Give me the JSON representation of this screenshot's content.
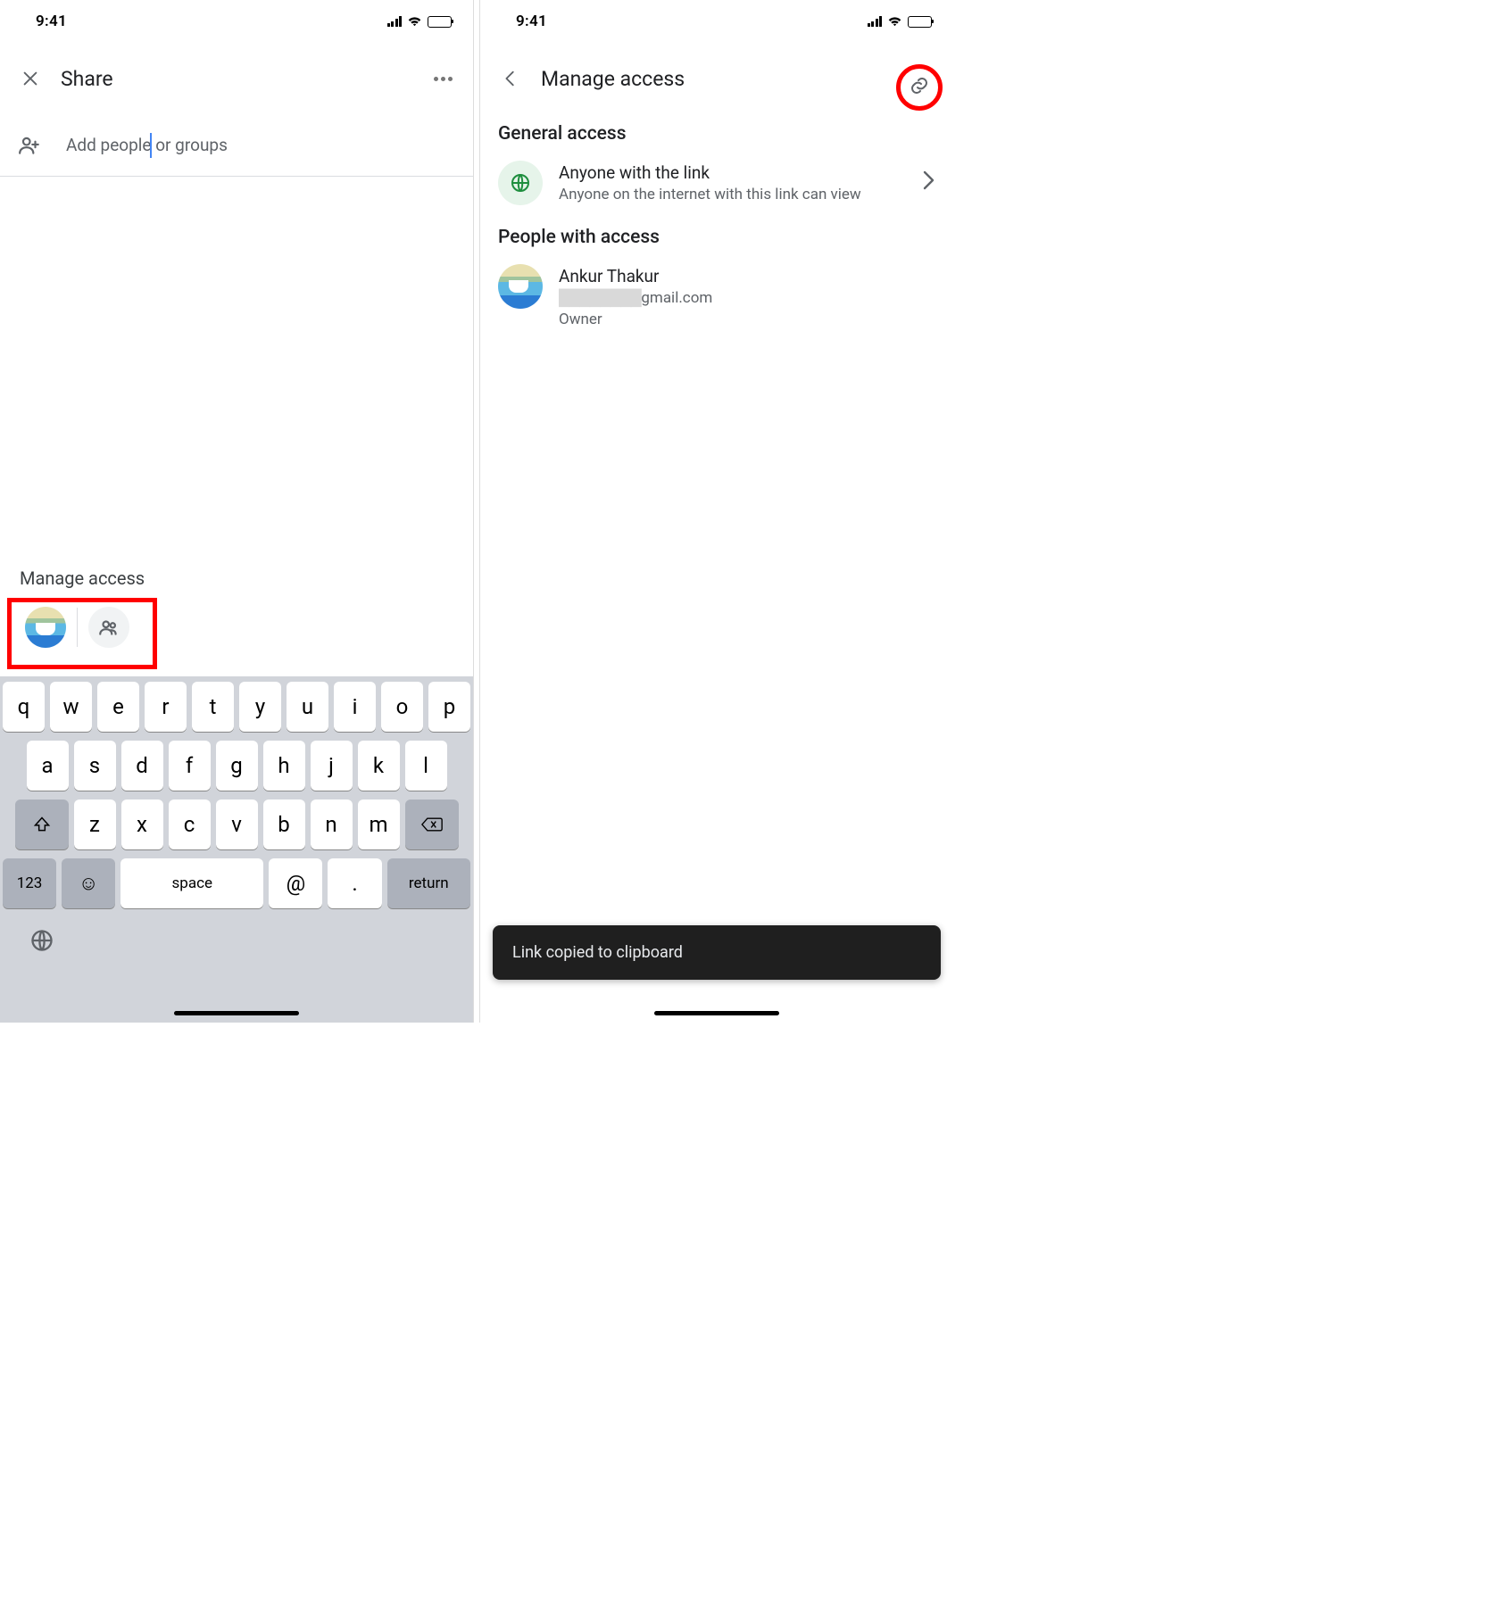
{
  "status": {
    "time": "9:41"
  },
  "left": {
    "header": {
      "title": "Share"
    },
    "addPeople": {
      "placeholder": "Add people or groups"
    },
    "manage": {
      "label": "Manage access"
    },
    "keyboard": {
      "row1": [
        "q",
        "w",
        "e",
        "r",
        "t",
        "y",
        "u",
        "i",
        "o",
        "p"
      ],
      "row2": [
        "a",
        "s",
        "d",
        "f",
        "g",
        "h",
        "j",
        "k",
        "l"
      ],
      "row3": [
        "z",
        "x",
        "c",
        "v",
        "b",
        "n",
        "m"
      ],
      "numKey": "123",
      "space": "space",
      "at": "@",
      "dot": ".",
      "return": "return"
    }
  },
  "right": {
    "header": {
      "title": "Manage access"
    },
    "general": {
      "heading": "General access",
      "item": {
        "title": "Anyone with the link",
        "desc": "Anyone on the internet with this link can view"
      }
    },
    "people": {
      "heading": "People with access",
      "owner": {
        "name": "Ankur Thakur",
        "emailHidden": "████████",
        "emailDomain": "gmail.com",
        "role": "Owner"
      }
    },
    "toast": "Link copied to clipboard"
  }
}
